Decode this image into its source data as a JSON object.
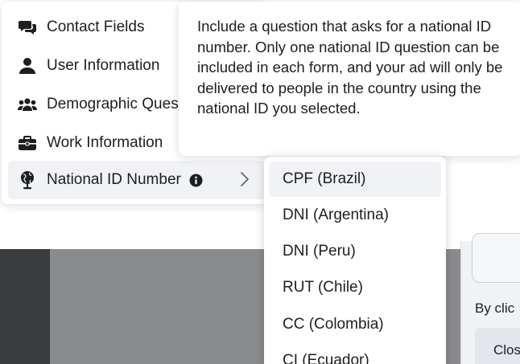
{
  "menu": {
    "items": [
      {
        "label": "Contact Fields",
        "icon": "chat-bubbles-icon"
      },
      {
        "label": "User Information",
        "icon": "person-icon"
      },
      {
        "label": "Demographic Ques",
        "icon": "people-group-icon"
      },
      {
        "label": "Work Information",
        "icon": "briefcase-icon"
      },
      {
        "label": "National ID Number",
        "icon": "globe-pin-icon"
      }
    ]
  },
  "tooltip": {
    "text": "Include a question that asks for a national ID number. Only one national ID question can be included in each form, and your ad will only be delivered to people in the country using the national ID you selected."
  },
  "submenu": {
    "items": [
      {
        "label": "CPF (Brazil)"
      },
      {
        "label": "DNI (Argentina)"
      },
      {
        "label": "DNI (Peru)"
      },
      {
        "label": "RUT (Chile)"
      },
      {
        "label": "CC (Colombia)"
      },
      {
        "label": "CI (Ecuador)"
      }
    ]
  },
  "background": {
    "right_text": "By clic",
    "right_button": "Clos"
  }
}
